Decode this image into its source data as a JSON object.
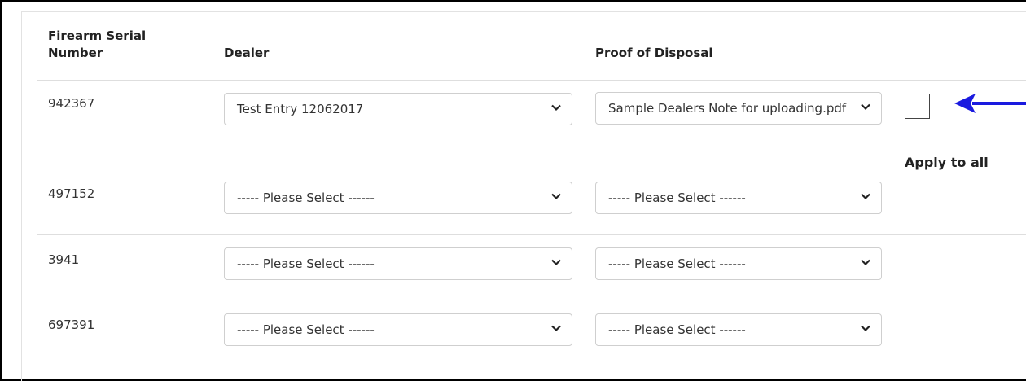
{
  "headers": {
    "serial_line1": "Firearm Serial",
    "serial_line2": "Number",
    "dealer": "Dealer",
    "proof": "Proof of Disposal"
  },
  "rows": [
    {
      "serial": "942367",
      "dealer": "Test Entry 12062017",
      "proof": "Sample Dealers Note for uploading.pdf"
    },
    {
      "serial": "497152",
      "dealer": "----- Please Select ------",
      "proof": "----- Please Select ------"
    },
    {
      "serial": "3941",
      "dealer": "----- Please Select ------",
      "proof": "----- Please Select ------"
    },
    {
      "serial": "697391",
      "dealer": "----- Please Select ------",
      "proof": "----- Please Select ------"
    }
  ],
  "apply_to_all": {
    "label": "Apply to all",
    "checked": false
  },
  "icons": {
    "chevron": "chevron-down-icon",
    "arrow": "arrow-left-icon"
  },
  "colors": {
    "arrow": "#1a1adf",
    "border": "#cfcfcf",
    "text": "#333333"
  }
}
